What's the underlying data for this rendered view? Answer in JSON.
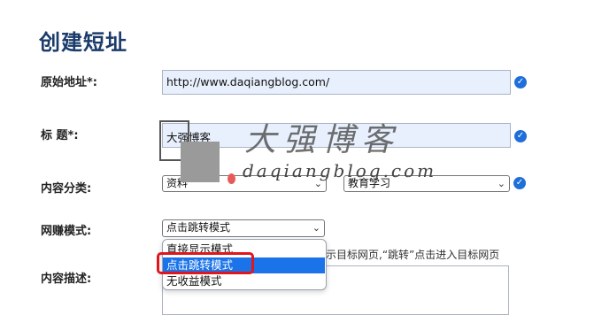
{
  "page": {
    "title": "创建短址"
  },
  "form": {
    "url": {
      "label": "原始地址*:",
      "value": "http://www.daqiangblog.com/"
    },
    "title": {
      "label": "标 题*:",
      "value": "大强博客"
    },
    "category": {
      "label": "内容分类:",
      "primary_value": "资料",
      "secondary_value": "教育学习"
    },
    "mode": {
      "label": "网赚模式:",
      "selected_value": "点击跳转模式",
      "options": [
        "直接显示模式",
        "点击跳转模式",
        "无收益模式"
      ],
      "help_text": "示目标网页,“跳转”点击进入目标网页"
    },
    "description": {
      "label": "内容描述:"
    }
  },
  "watermark": {
    "brand": "大强博客",
    "domain": "daqiangblog.com"
  },
  "colors": {
    "title": "#1b3b6b",
    "check": "#1e6fd9",
    "selected_option": "#1a73e8",
    "highlight": "#e0161d"
  }
}
